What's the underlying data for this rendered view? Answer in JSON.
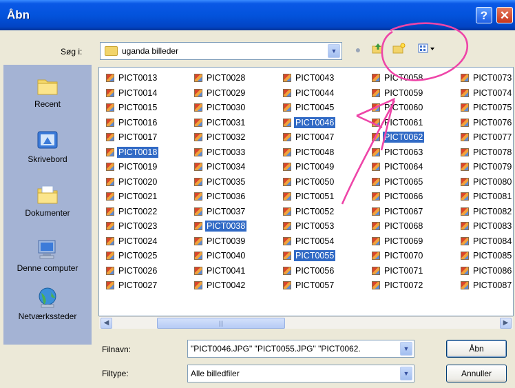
{
  "window": {
    "title": "Åbn",
    "help": "?",
    "close": "✕"
  },
  "lookin": {
    "label": "Søg i:",
    "value": "uganda billeder"
  },
  "places": [
    "Recent",
    "Skrivebord",
    "Dokumenter",
    "Denne computer",
    "Netværkssteder"
  ],
  "columns": [
    [
      "PICT0013",
      "PICT0014",
      "PICT0015",
      "PICT0016",
      "PICT0017",
      "PICT0018",
      "PICT0019",
      "PICT0020",
      "PICT0021",
      "PICT0022",
      "PICT0023",
      "PICT0024",
      "PICT0025",
      "PICT0026",
      "PICT0027"
    ],
    [
      "PICT0028",
      "PICT0029",
      "PICT0030",
      "PICT0031",
      "PICT0032",
      "PICT0033",
      "PICT0034",
      "PICT0035",
      "PICT0036",
      "PICT0037",
      "PICT0038",
      "PICT0039",
      "PICT0040",
      "PICT0041",
      "PICT0042"
    ],
    [
      "PICT0043",
      "PICT0044",
      "PICT0045",
      "PICT0046",
      "PICT0047",
      "PICT0048",
      "PICT0049",
      "PICT0050",
      "PICT0051",
      "PICT0052",
      "PICT0053",
      "PICT0054",
      "PICT0055",
      "PICT0056",
      "PICT0057"
    ],
    [
      "PICT0058",
      "PICT0059",
      "PICT0060",
      "PICT0061",
      "PICT0062",
      "PICT0063",
      "PICT0064",
      "PICT0065",
      "PICT0066",
      "PICT0067",
      "PICT0068",
      "PICT0069",
      "PICT0070",
      "PICT0071",
      "PICT0072"
    ],
    [
      "PICT0073",
      "PICT0074",
      "PICT0075",
      "PICT0076",
      "PICT0077",
      "PICT0078",
      "PICT0079",
      "PICT0080",
      "PICT0081",
      "PICT0082",
      "PICT0083",
      "PICT0084",
      "PICT0085",
      "PICT0086",
      "PICT0087"
    ]
  ],
  "selected": [
    "PICT0018",
    "PICT0038",
    "PICT0046",
    "PICT0055",
    "PICT0062"
  ],
  "filename": {
    "label": "Filnavn:",
    "value": "\"PICT0046.JPG\" \"PICT0055.JPG\" \"PICT0062."
  },
  "filetype": {
    "label": "Filtype:",
    "value": "Alle billedfiler"
  },
  "buttons": {
    "open": "Åbn",
    "cancel": "Annuller"
  },
  "colors": {
    "selection": "#316AC5",
    "annotation": "#EE45A8",
    "titlebar": "#0353DC"
  }
}
